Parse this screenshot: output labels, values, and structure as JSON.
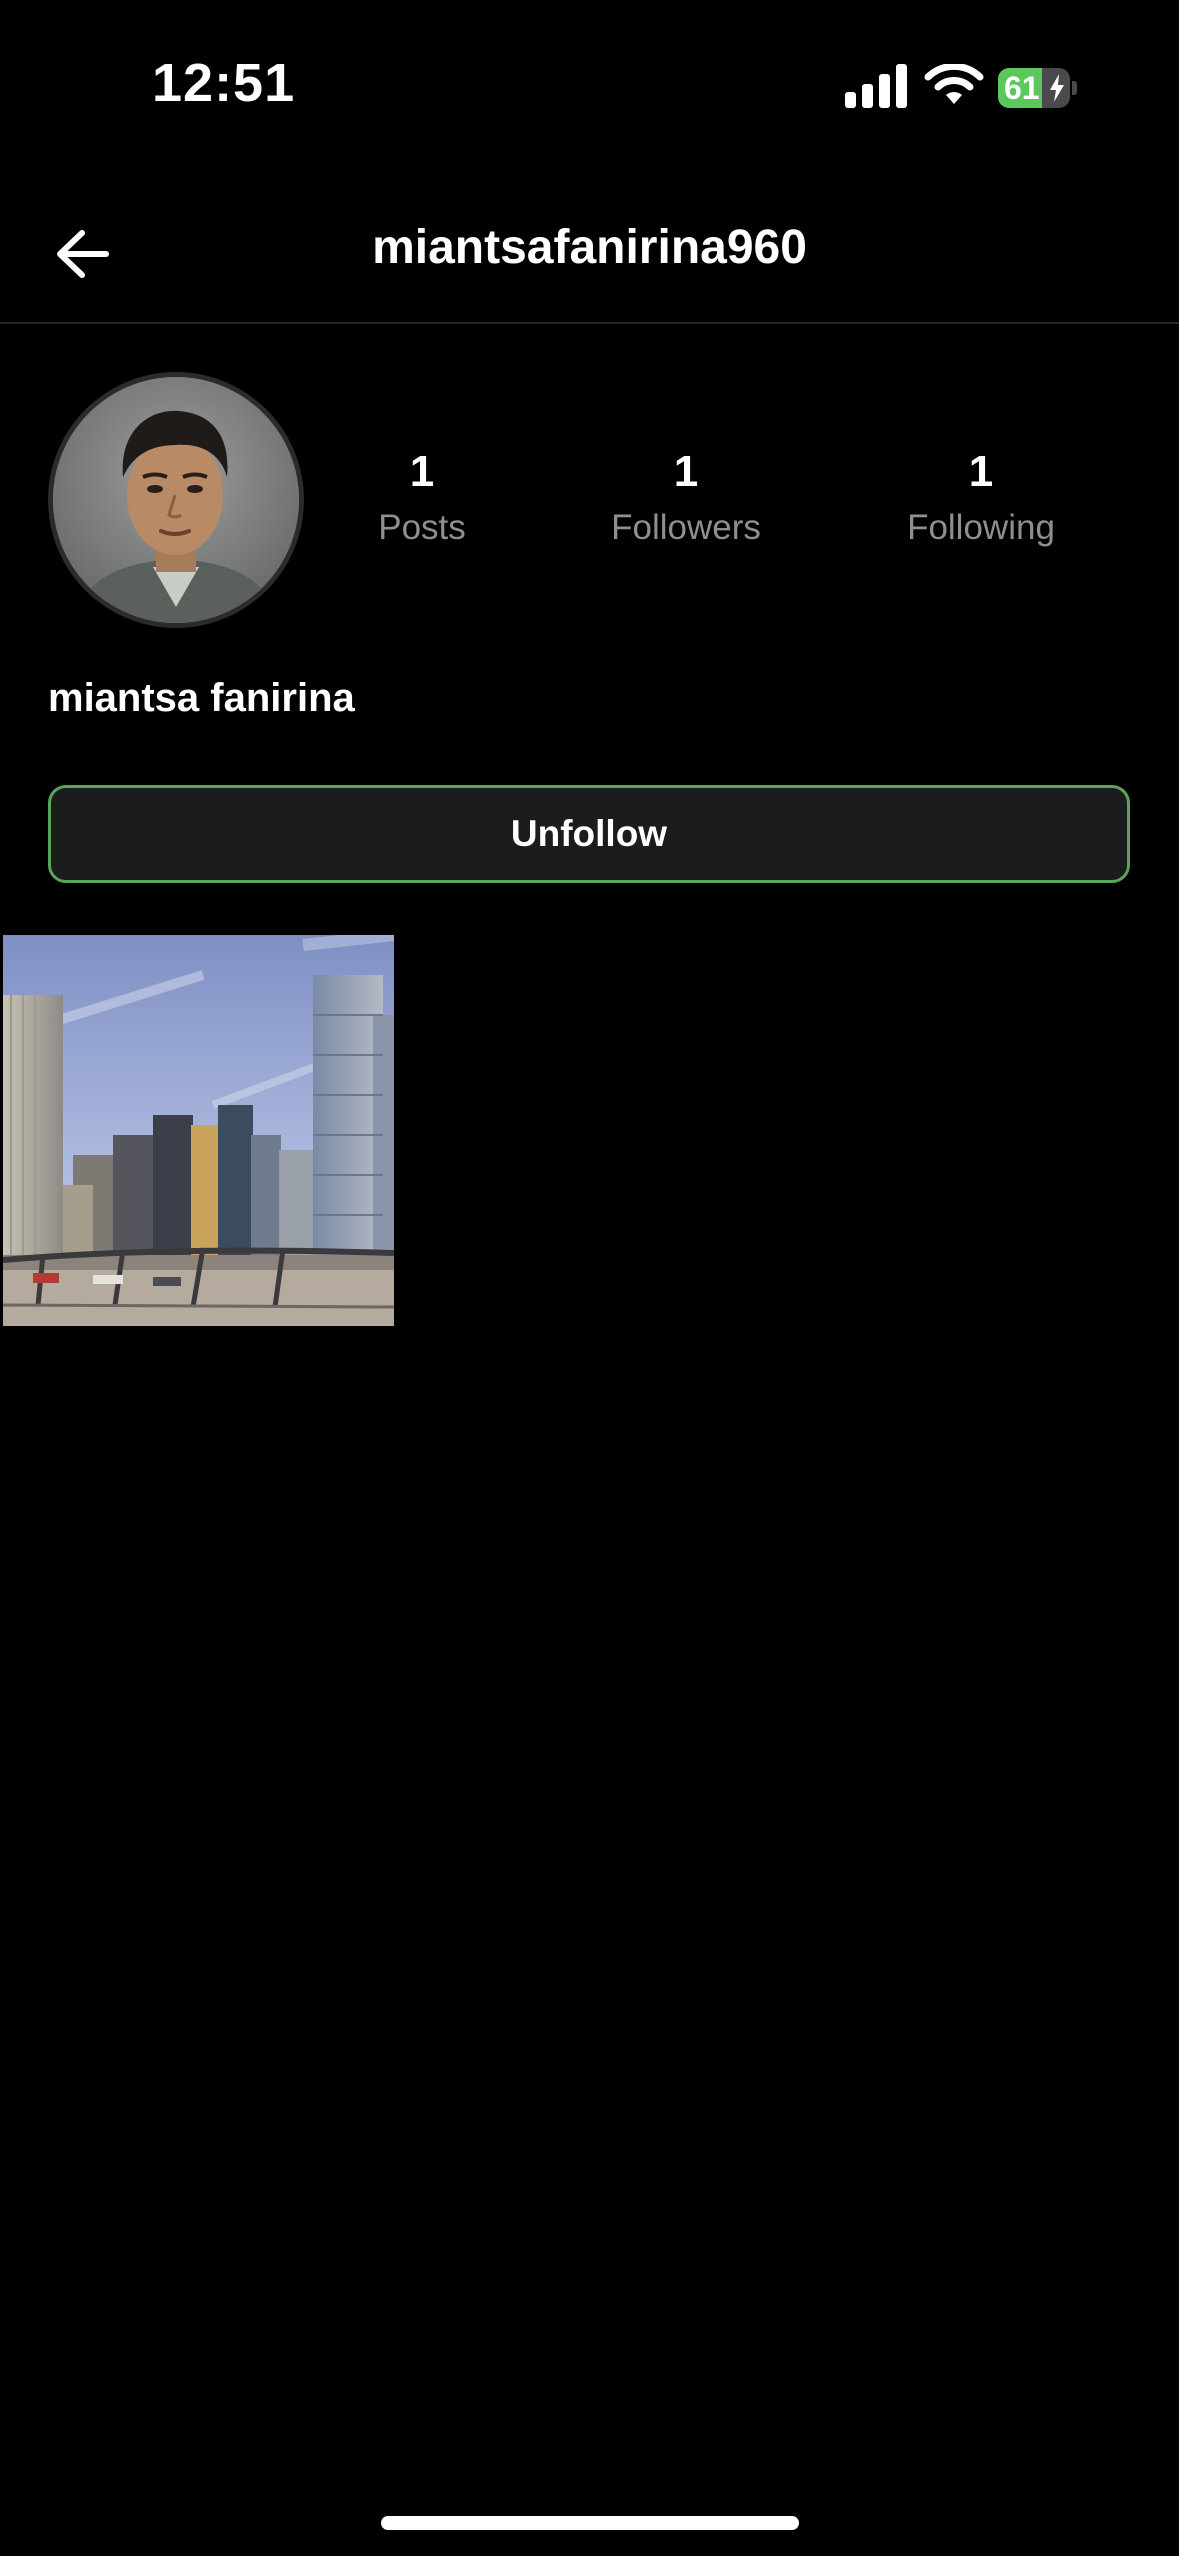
{
  "status_bar": {
    "time": "12:51",
    "battery_level": "61",
    "battery_fraction": 0.61,
    "battery_color": "#5ac85a",
    "charging": true,
    "icons": [
      "cellular-signal-icon",
      "wifi-icon",
      "battery-charging-icon"
    ]
  },
  "nav": {
    "title": "miantsafanirina960",
    "back_icon": "arrow-left-icon"
  },
  "profile": {
    "avatar_icon": "profile-photo",
    "stats": [
      {
        "value": "1",
        "label": "Posts"
      },
      {
        "value": "1",
        "label": "Followers"
      },
      {
        "value": "1",
        "label": "Following"
      }
    ],
    "display_name": "miantsa fanirina",
    "unfollow_label": "Unfollow",
    "button_border_color": "#5aa55a"
  },
  "posts": [
    {
      "thumbnail": "city-skyline-photo"
    }
  ]
}
